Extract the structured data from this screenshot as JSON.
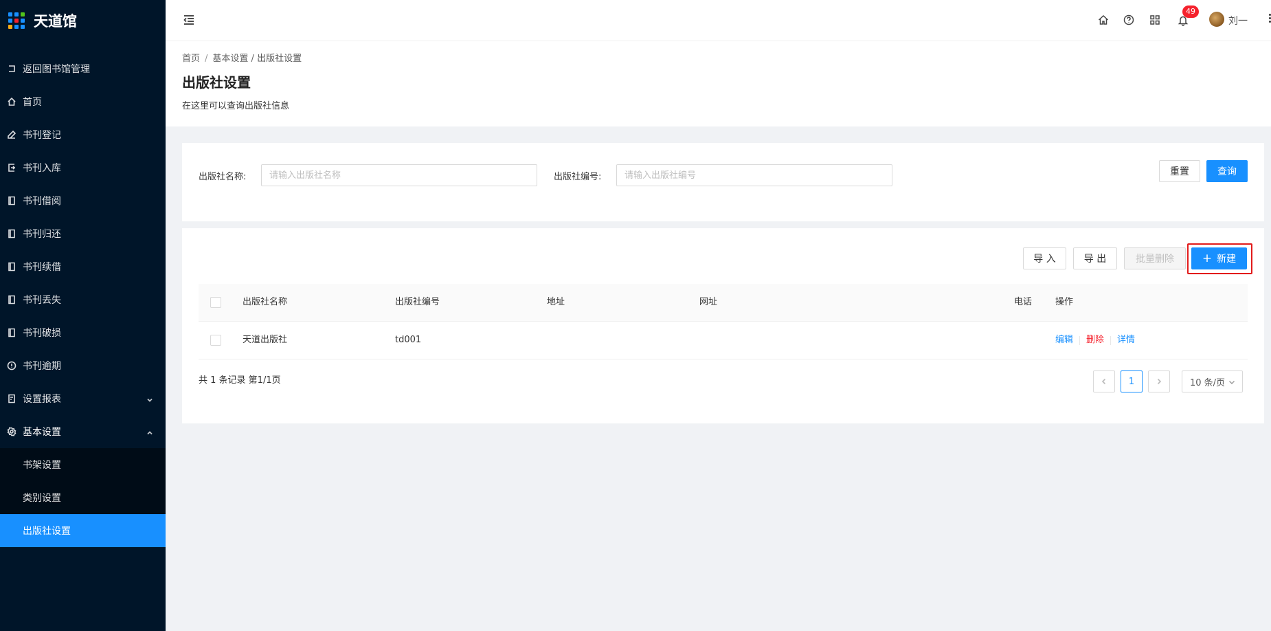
{
  "app": {
    "title": "天道馆"
  },
  "colors": {
    "primary": "#1890ff",
    "sidebar_bg": "#001529",
    "danger": "#f5222d",
    "highlight": "#e21b1b"
  },
  "sidebar": {
    "items": [
      {
        "label": "返回图书馆管理",
        "icon": "return-icon"
      },
      {
        "label": "首页",
        "icon": "home-icon"
      },
      {
        "label": "书刊登记",
        "icon": "pen-icon"
      },
      {
        "label": "书刊入库",
        "icon": "import-icon"
      },
      {
        "label": "书刊借阅",
        "icon": "book-icon"
      },
      {
        "label": "书刊归还",
        "icon": "book-icon"
      },
      {
        "label": "书刊续借",
        "icon": "book-icon"
      },
      {
        "label": "书刊丢失",
        "icon": "book-icon"
      },
      {
        "label": "书刊破损",
        "icon": "book-icon"
      },
      {
        "label": "书刊逾期",
        "icon": "info-circle-icon"
      },
      {
        "label": "设置报表",
        "icon": "report-icon"
      },
      {
        "label": "基本设置",
        "icon": "gear-icon"
      }
    ],
    "submenu": [
      {
        "label": "书架设置"
      },
      {
        "label": "类别设置"
      },
      {
        "label": "出版社设置"
      }
    ]
  },
  "header": {
    "notification_count": "49",
    "user_name": "刘一"
  },
  "breadcrumb": {
    "items": [
      "首页",
      "基本设置"
    ],
    "current": "出版社设置"
  },
  "page": {
    "title": "出版社设置",
    "description": "在这里可以查询出版社信息"
  },
  "search": {
    "name_label": "出版社名称:",
    "name_placeholder": "请输入出版社名称",
    "code_label": "出版社编号:",
    "code_placeholder": "请输入出版社编号",
    "reset_label": "重置",
    "query_label": "查询"
  },
  "toolbar": {
    "import_label": "导 入",
    "export_label": "导 出",
    "batch_delete_label": "批量删除",
    "new_label": "新建"
  },
  "table": {
    "columns": [
      "出版社名称",
      "出版社编号",
      "地址",
      "网址",
      "电话",
      "操作"
    ],
    "rows": [
      {
        "name": "天道出版社",
        "code": "td001",
        "address": "",
        "website": "",
        "phone": ""
      }
    ],
    "actions": {
      "edit": "编辑",
      "delete": "删除",
      "detail": "详情"
    }
  },
  "pagination": {
    "summary": "共 1 条记录 第1/1页",
    "current_page": "1",
    "page_size": "10 条/页"
  }
}
